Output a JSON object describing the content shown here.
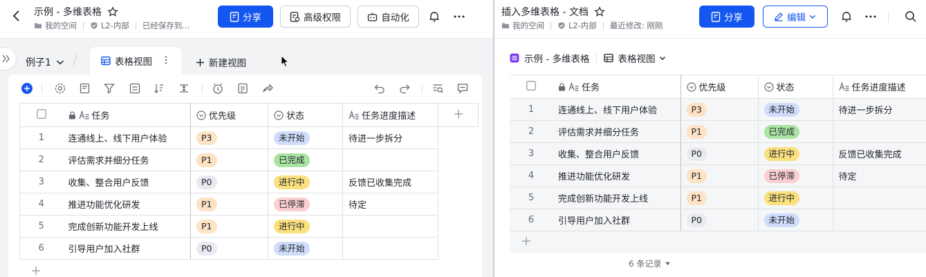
{
  "left": {
    "title": "示例 - 多维表格",
    "meta": {
      "space": "我的空间",
      "security": "L2-内部",
      "status": "已经保存到..."
    },
    "buttons": {
      "share": "分享",
      "permissions": "高级权限",
      "automation": "自动化"
    },
    "view_name": "例子1",
    "tab_label": "表格视图",
    "new_view": "新建视图"
  },
  "right": {
    "title": "插入多维表格 - 文档",
    "meta": {
      "space": "我的空间",
      "security": "L2-内部",
      "modified": "最近修改: 刚刚"
    },
    "buttons": {
      "share": "分享",
      "edit": "编辑"
    },
    "embed_name": "示例 - 多维表格",
    "embed_view": "表格视图",
    "records": "6 条记录"
  },
  "columns": {
    "task": "任务",
    "priority": "优先级",
    "status": "状态",
    "desc": "任务进度描述"
  },
  "rows": [
    {
      "num": "1",
      "task": "连通线上、线下用户体验",
      "priority": "P3",
      "status": "未开始",
      "desc": "待进一步拆分"
    },
    {
      "num": "2",
      "task": "评估需求并细分任务",
      "priority": "P1",
      "status": "已完成",
      "desc": ""
    },
    {
      "num": "3",
      "task": "收集、整合用户反馈",
      "priority": "P0",
      "status": "进行中",
      "desc": "反馈已收集完成"
    },
    {
      "num": "4",
      "task": "推进功能优化研发",
      "priority": "P1",
      "status": "已停滞",
      "desc": "待定"
    },
    {
      "num": "5",
      "task": "完成创新功能开发上线",
      "priority": "P1",
      "status": "进行中",
      "desc": ""
    },
    {
      "num": "6",
      "task": "引导用户加入社群",
      "priority": "P0",
      "status": "未开始",
      "desc": ""
    }
  ],
  "colors": {
    "primary": "#1456f0",
    "P3": "#fde2c4",
    "P1": "#fde2c4",
    "P0": "#e8eaef",
    "未开始": "#d0dcfb",
    "已完成": "#a9e4a2",
    "进行中": "#fbe07e",
    "已停滞": "#fbcfcf"
  },
  "icons": [
    "back-icon",
    "star-icon",
    "folder-icon",
    "shield-icon",
    "share-doc-icon",
    "permission-icon",
    "robot-icon",
    "bell-icon",
    "more-icon",
    "search-icon",
    "pencil-icon",
    "chevron-down-icon",
    "grid-view-icon",
    "plus-icon",
    "lock-icon",
    "text-field-icon",
    "single-select-icon",
    "expand-sidebar-icon",
    "checkbox-icon"
  ]
}
